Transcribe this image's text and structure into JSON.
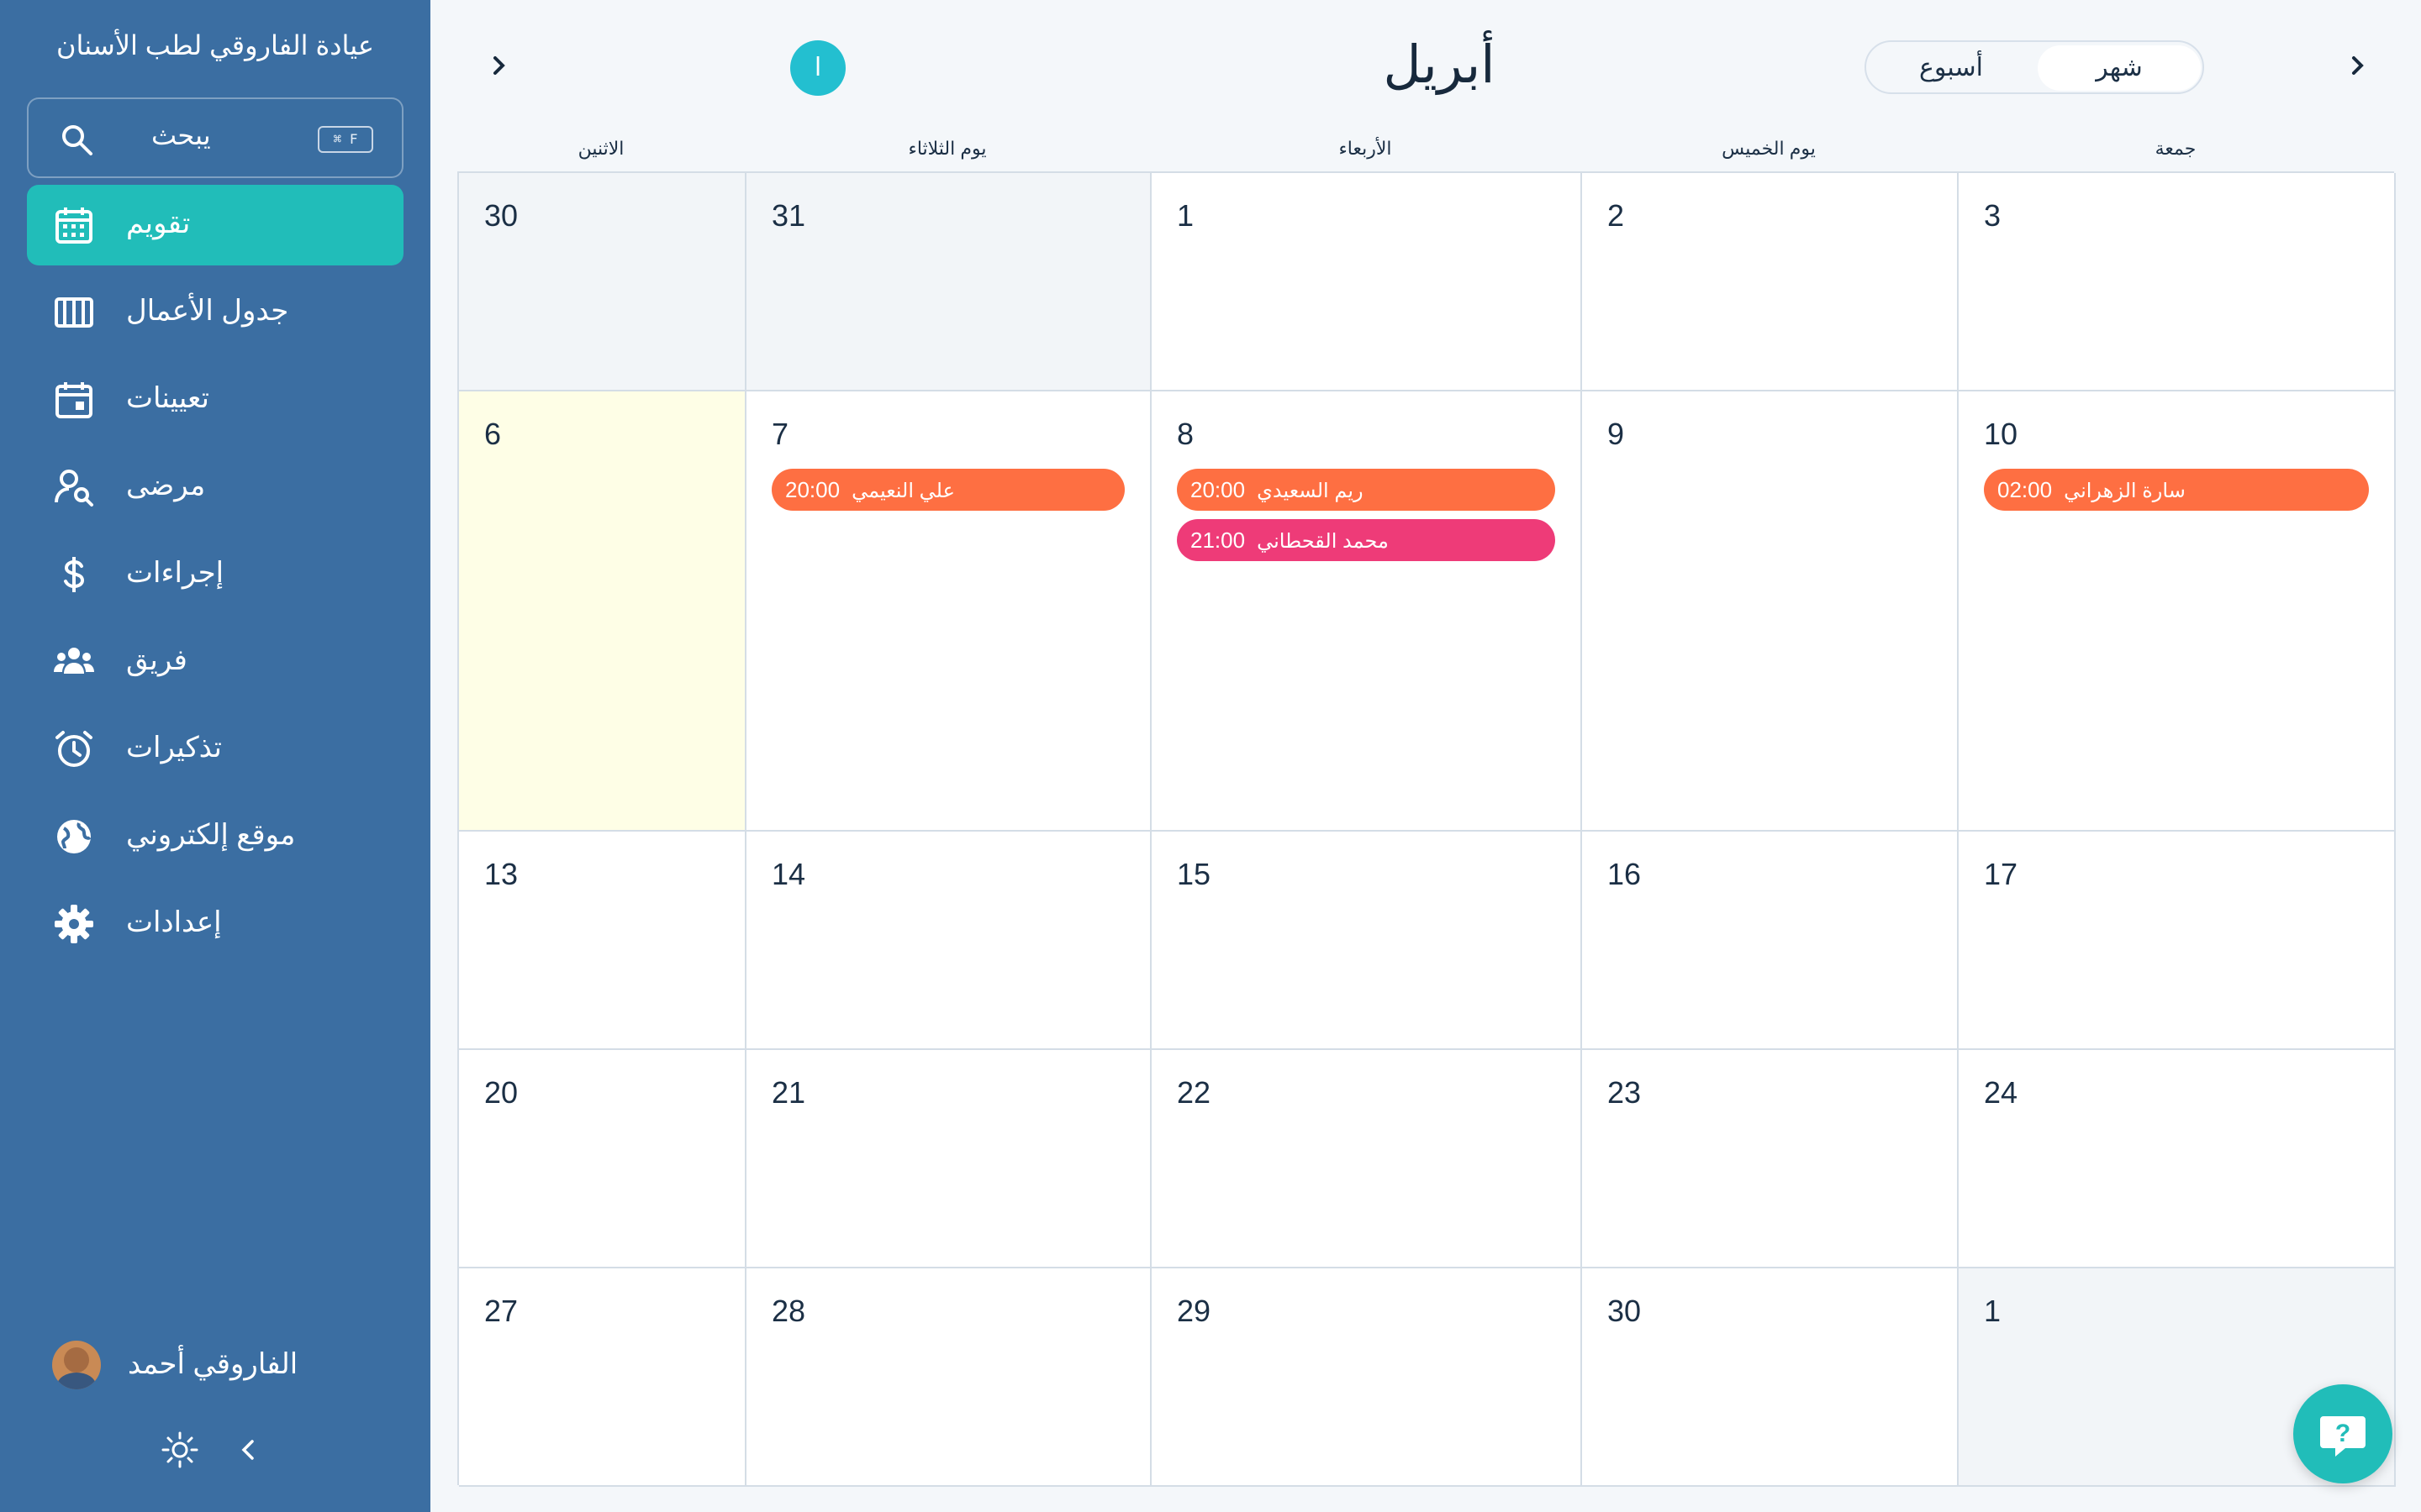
{
  "sidebar": {
    "clinic_name": "عيادة الفاروقي لطب الأسنان",
    "search": {
      "label": "يبحث",
      "shortcut": "⌘ F"
    },
    "items": [
      {
        "label": "تقويم",
        "icon": "calendar-icon",
        "active": true
      },
      {
        "label": "جدول الأعمال",
        "icon": "columns-icon"
      },
      {
        "label": "تعيينات",
        "icon": "calendar-event-icon"
      },
      {
        "label": "مرضى",
        "icon": "user-search-icon"
      },
      {
        "label": "إجراءات",
        "icon": "dollar-icon"
      },
      {
        "label": "فريق",
        "icon": "team-icon"
      },
      {
        "label": "تذكيرات",
        "icon": "alarm-icon"
      },
      {
        "label": "موقع إلكتروني",
        "icon": "globe-icon"
      },
      {
        "label": "إعدادات",
        "icon": "gear-icon"
      }
    ],
    "user": {
      "name": "الفاروقي أحمد"
    }
  },
  "calendar": {
    "month": "أبريل",
    "badge": "ا",
    "view_toggle": {
      "month": "شهر",
      "week": "أسبوع",
      "selected": "month"
    },
    "day_headers": [
      "الاثنين",
      "يوم الثلاثاء",
      "الأربعاء",
      "يوم الخميس",
      "جمعة"
    ],
    "weeks": [
      [
        {
          "day": "30",
          "state": "other"
        },
        {
          "day": "31",
          "state": "other"
        },
        {
          "day": "1"
        },
        {
          "day": "2"
        },
        {
          "day": "3"
        }
      ],
      [
        {
          "day": "6",
          "state": "today"
        },
        {
          "day": "7",
          "events": [
            {
              "time": "20:00",
              "name": "علي النعيمي",
              "color": "#fe6f42"
            }
          ]
        },
        {
          "day": "8",
          "events": [
            {
              "time": "20:00",
              "name": "ريم السعيدي",
              "color": "#fe6f42"
            },
            {
              "time": "21:00",
              "name": "محمد القحطاني",
              "color": "#ee3b78"
            }
          ]
        },
        {
          "day": "9"
        },
        {
          "day": "10",
          "events": [
            {
              "time": "02:00",
              "name": "سارة الزهراني",
              "color": "#fe6f42"
            }
          ]
        }
      ],
      [
        {
          "day": "13"
        },
        {
          "day": "14"
        },
        {
          "day": "15"
        },
        {
          "day": "16"
        },
        {
          "day": "17"
        }
      ],
      [
        {
          "day": "20"
        },
        {
          "day": "21"
        },
        {
          "day": "22"
        },
        {
          "day": "23"
        },
        {
          "day": "24"
        }
      ],
      [
        {
          "day": "27"
        },
        {
          "day": "28"
        },
        {
          "day": "29"
        },
        {
          "day": "30"
        },
        {
          "day": "1",
          "state": "other"
        }
      ]
    ]
  },
  "colors": {
    "sidebar": "#3b6ea2",
    "accent": "#21bdb9",
    "event_orange": "#fe6f42",
    "event_pink": "#ee3b78",
    "today": "#fefee6"
  }
}
